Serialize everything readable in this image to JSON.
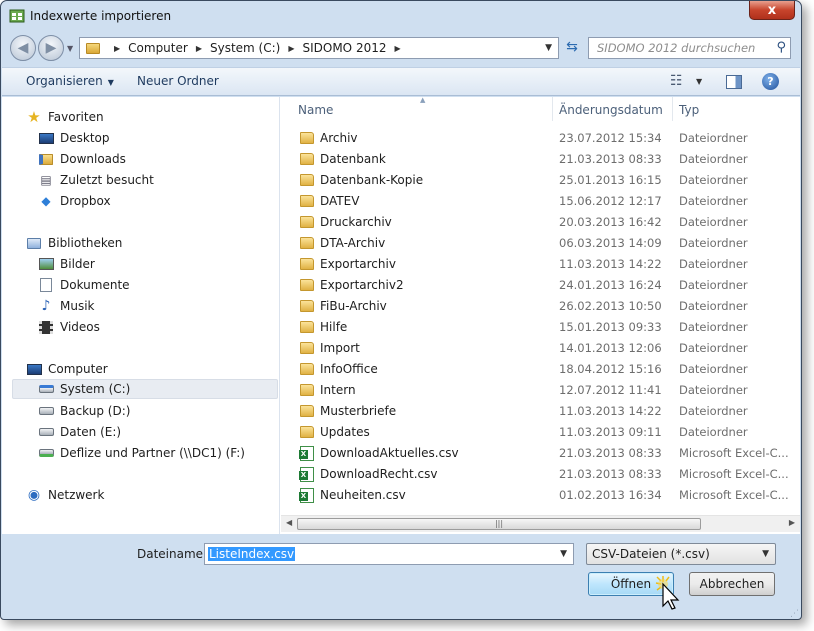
{
  "window": {
    "title": "Indexwerte importieren",
    "close_label": "x"
  },
  "nav": {
    "breadcrumbs": [
      "Computer",
      "System (C:)",
      "SIDOMO 2012"
    ],
    "search_placeholder": "SIDOMO 2012 durchsuchen"
  },
  "toolbar": {
    "organize": "Organisieren",
    "new_folder": "Neuer Ordner",
    "help": "?"
  },
  "sidebar": {
    "favorites": {
      "header": "Favoriten",
      "items": [
        "Desktop",
        "Downloads",
        "Zuletzt besucht",
        "Dropbox"
      ]
    },
    "libraries": {
      "header": "Bibliotheken",
      "items": [
        "Bilder",
        "Dokumente",
        "Musik",
        "Videos"
      ]
    },
    "computer": {
      "header": "Computer",
      "items": [
        "System (C:)",
        "Backup (D:)",
        "Daten (E:)",
        "Deflize und Partner (\\\\DC1) (F:)"
      ]
    },
    "network": {
      "header": "Netzwerk"
    }
  },
  "columns": {
    "name": "Name",
    "date": "Änderungsdatum",
    "type": "Typ"
  },
  "files": [
    {
      "name": "Archiv",
      "date": "23.07.2012 15:34",
      "type": "Dateiordner",
      "kind": "folder"
    },
    {
      "name": "Datenbank",
      "date": "21.03.2013 08:33",
      "type": "Dateiordner",
      "kind": "folder"
    },
    {
      "name": "Datenbank-Kopie",
      "date": "25.01.2013 16:15",
      "type": "Dateiordner",
      "kind": "folder"
    },
    {
      "name": "DATEV",
      "date": "15.06.2012 12:17",
      "type": "Dateiordner",
      "kind": "folder"
    },
    {
      "name": "Druckarchiv",
      "date": "20.03.2013 16:42",
      "type": "Dateiordner",
      "kind": "folder"
    },
    {
      "name": "DTA-Archiv",
      "date": "06.03.2013 14:09",
      "type": "Dateiordner",
      "kind": "folder"
    },
    {
      "name": "Exportarchiv",
      "date": "11.03.2013 14:22",
      "type": "Dateiordner",
      "kind": "folder"
    },
    {
      "name": "Exportarchiv2",
      "date": "24.01.2013 16:24",
      "type": "Dateiordner",
      "kind": "folder"
    },
    {
      "name": "FiBu-Archiv",
      "date": "26.02.2013 10:50",
      "type": "Dateiordner",
      "kind": "folder"
    },
    {
      "name": "Hilfe",
      "date": "15.01.2013 09:33",
      "type": "Dateiordner",
      "kind": "folder"
    },
    {
      "name": "Import",
      "date": "14.01.2013 12:06",
      "type": "Dateiordner",
      "kind": "folder"
    },
    {
      "name": "InfoOffice",
      "date": "18.04.2012 15:16",
      "type": "Dateiordner",
      "kind": "folder"
    },
    {
      "name": "Intern",
      "date": "12.07.2012 11:41",
      "type": "Dateiordner",
      "kind": "folder"
    },
    {
      "name": "Musterbriefe",
      "date": "11.03.2013 14:22",
      "type": "Dateiordner",
      "kind": "folder"
    },
    {
      "name": "Updates",
      "date": "11.03.2013 09:11",
      "type": "Dateiordner",
      "kind": "folder"
    },
    {
      "name": "DownloadAktuelles.csv",
      "date": "21.03.2013 08:33",
      "type": "Microsoft Excel-C...",
      "kind": "csv"
    },
    {
      "name": "DownloadRecht.csv",
      "date": "21.03.2013 08:33",
      "type": "Microsoft Excel-C...",
      "kind": "csv"
    },
    {
      "name": "Neuheiten.csv",
      "date": "01.02.2013 16:34",
      "type": "Microsoft Excel-C...",
      "kind": "csv"
    }
  ],
  "footer": {
    "filename_label": "Dateiname:",
    "filename_value": "ListeIndex.csv",
    "filter_value": "CSV-Dateien (*.csv)",
    "open_label": "Öffnen",
    "cancel_label": "Abbrechen"
  }
}
